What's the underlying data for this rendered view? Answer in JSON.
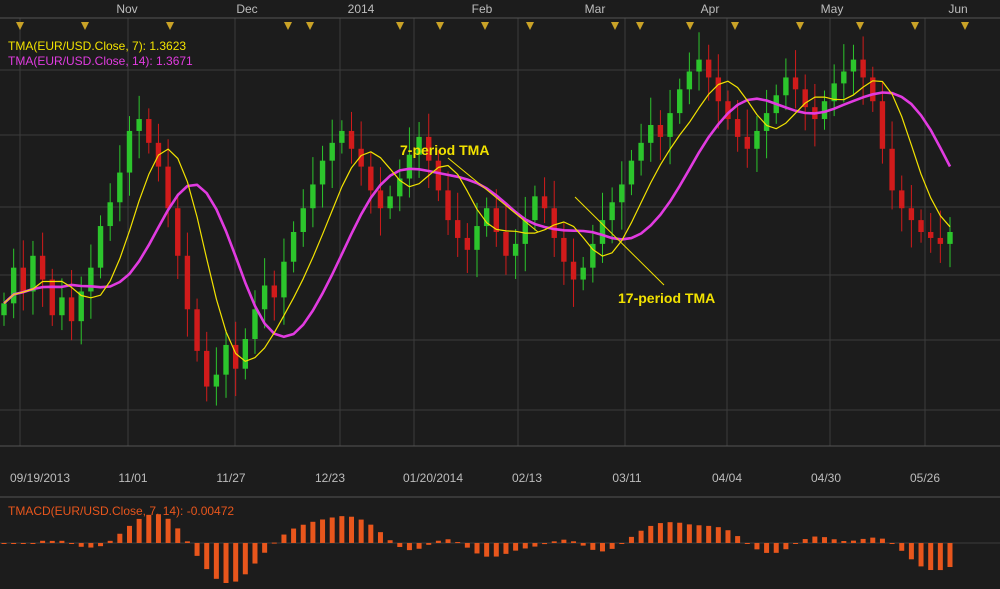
{
  "colors": {
    "background": "#1c1c1c",
    "grid": "#3c3c3c",
    "axis_text": "#bdbdbd",
    "candle_up": "#2cc52c",
    "candle_down": "#d11b1b",
    "tma7": "#f2e200",
    "tma14": "#e13be0",
    "macd_bar": "#e8561c",
    "event_marker": "#c9a227"
  },
  "legend": {
    "tma7": "TMA(EUR/USD.Close, 7): 1.3623",
    "tma14": "TMA(EUR/USD.Close, 14): 1.3671",
    "tmacd": "TMACD(EUR/USD.Close, 7, 14): -0.00472"
  },
  "annotations": {
    "tma7_label": "7-period TMA",
    "tma17_label": "17-period TMA"
  },
  "chart_data": [
    {
      "type": "candlestick",
      "symbol": "EUR/USD",
      "grid": true,
      "top_axis_labels": [
        "Nov",
        "Dec",
        "2014",
        "Feb",
        "Mar",
        "Apr",
        "May",
        "Jun"
      ],
      "bottom_axis_labels": [
        "09/19/2013",
        "11/01",
        "11/27",
        "12/23",
        "01/20/2014",
        "02/13",
        "03/11",
        "04/04",
        "04/30",
        "05/26"
      ],
      "close_series": [
        1.35,
        1.356,
        1.352,
        1.358,
        1.354,
        1.348,
        1.351,
        1.347,
        1.352,
        1.356,
        1.363,
        1.367,
        1.372,
        1.379,
        1.381,
        1.377,
        1.373,
        1.366,
        1.358,
        1.349,
        1.342,
        1.336,
        1.338,
        1.343,
        1.339,
        1.344,
        1.349,
        1.353,
        1.351,
        1.357,
        1.362,
        1.366,
        1.37,
        1.374,
        1.377,
        1.379,
        1.376,
        1.373,
        1.369,
        1.366,
        1.368,
        1.371,
        1.375,
        1.378,
        1.374,
        1.369,
        1.364,
        1.361,
        1.359,
        1.363,
        1.366,
        1.362,
        1.358,
        1.36,
        1.364,
        1.368,
        1.366,
        1.361,
        1.357,
        1.354,
        1.356,
        1.36,
        1.364,
        1.367,
        1.37,
        1.374,
        1.377,
        1.38,
        1.378,
        1.382,
        1.386,
        1.389,
        1.391,
        1.388,
        1.384,
        1.381,
        1.378,
        1.376,
        1.379,
        1.382,
        1.385,
        1.388,
        1.386,
        1.383,
        1.381,
        1.384,
        1.387,
        1.389,
        1.391,
        1.388,
        1.384,
        1.376,
        1.369,
        1.366,
        1.364,
        1.362,
        1.361,
        1.36,
        1.362
      ],
      "series": [
        {
          "name": "TMA(EUR/USD.Close, 7)",
          "last": 1.3623
        },
        {
          "name": "TMA(EUR/USD.Close, 14)",
          "last": 1.3671
        }
      ],
      "annotations": [
        "7-period TMA",
        "17-period TMA"
      ],
      "ylim": [
        1.326,
        1.398
      ]
    },
    {
      "type": "bar",
      "name": "TMACD(EUR/USD.Close, 7, 14)",
      "last": -0.00472
    }
  ]
}
